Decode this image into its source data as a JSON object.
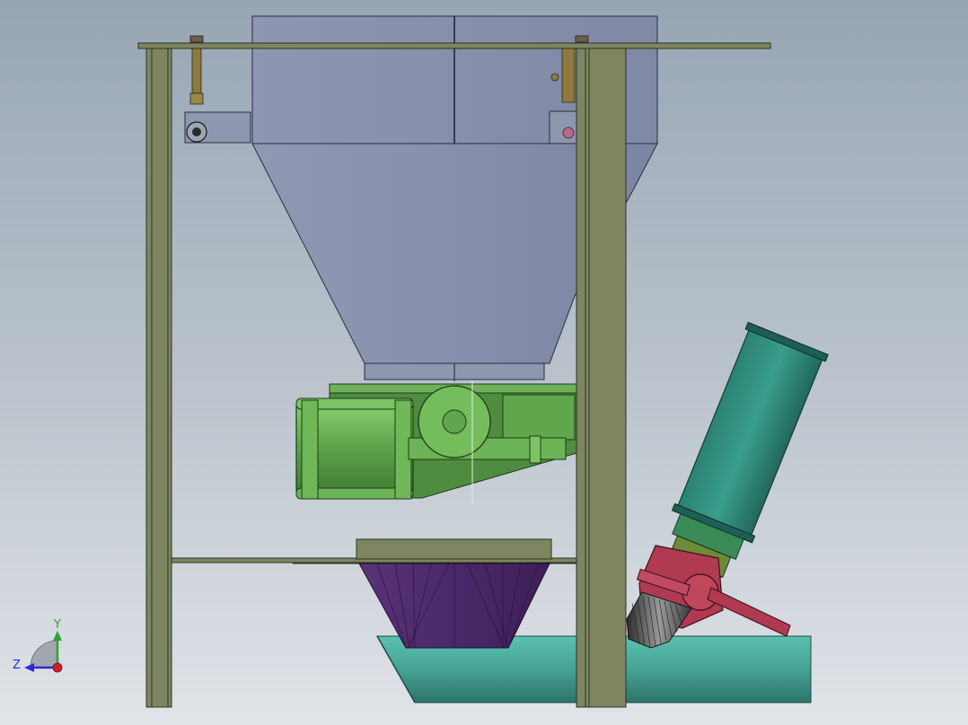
{
  "view": {
    "background_top": "#97a5b4",
    "background_bottom": "#e1e4e8"
  },
  "triad": {
    "y_label": "Y",
    "z_label": "Z",
    "y_color": "#2fa22f",
    "z_color": "#2a2ad6",
    "x_color": "#d01c2c"
  },
  "colors": {
    "frame": "#7d8661",
    "hopper": "#8891ab",
    "cylinder": "#5fa64c",
    "teal_motor": "#2f8c7b",
    "valve": "#b03a52",
    "pipe": "#4aa598",
    "funnel": "#4d2a6b"
  }
}
